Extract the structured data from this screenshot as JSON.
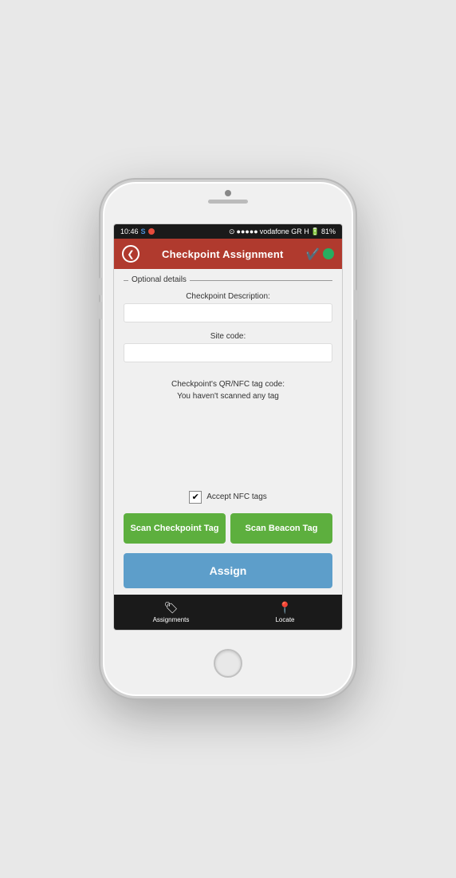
{
  "statusBar": {
    "time": "10:46",
    "carrier": "vodafone GR H",
    "battery": "81%",
    "skype": "S",
    "alarm": "⊙"
  },
  "header": {
    "title": "Checkpoint Assignment",
    "backLabel": "❮",
    "checkIcon": "✔",
    "greenDot": true
  },
  "optionalSection": {
    "label": "Optional details"
  },
  "fields": {
    "descriptionLabel": "Checkpoint Description:",
    "descriptionPlaceholder": "",
    "siteCodeLabel": "Site code:",
    "siteCodePlaceholder": "",
    "tagInfoLine1": "Checkpoint's QR/NFC tag code:",
    "tagInfoLine2": "You haven't scanned any tag"
  },
  "nfc": {
    "label": "Accept NFC tags",
    "checked": true,
    "checkmark": "✔"
  },
  "buttons": {
    "scanCheckpoint": "Scan Checkpoint Tag",
    "scanBeacon": "Scan Beacon Tag",
    "assign": "Assign"
  },
  "bottomNav": {
    "items": [
      {
        "label": "Assignments",
        "icon": "🏷"
      },
      {
        "label": "Locate",
        "icon": "📍"
      }
    ]
  }
}
